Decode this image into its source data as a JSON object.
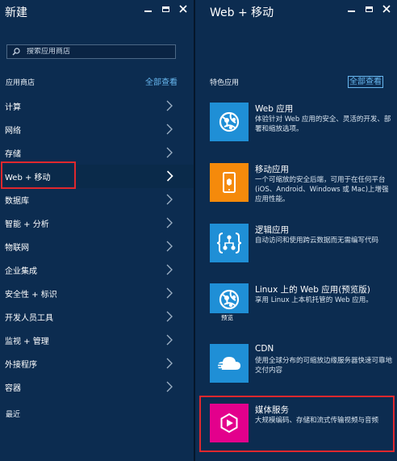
{
  "left_blade": {
    "title": "新建",
    "search_placeholder": "搜索应用商店",
    "section_label": "应用商店",
    "see_all": "全部查看",
    "menu": [
      {
        "label": "计算"
      },
      {
        "label": "网络"
      },
      {
        "label": "存储"
      },
      {
        "label": "Web + 移动",
        "active": true
      },
      {
        "label": "数据库"
      },
      {
        "label": "智能 + 分析"
      },
      {
        "label": "物联网"
      },
      {
        "label": "企业集成"
      },
      {
        "label": "安全性 + 标识"
      },
      {
        "label": "开发人员工具"
      },
      {
        "label": "监视 + 管理"
      },
      {
        "label": "外接程序"
      },
      {
        "label": "容器"
      }
    ],
    "recent_label": "最近"
  },
  "right_blade": {
    "title": "Web + 移动",
    "section_label": "特色应用",
    "see_all": "全部查看",
    "apps": [
      {
        "name": "Web 应用",
        "desc": "体验针对 Web 应用的安全、灵活的开发、部署和缩放选项。",
        "color": "#1f8fd6",
        "icon": "globe-icon"
      },
      {
        "name": "移动应用",
        "desc": "一个可缩放的安全后端，可用于在任何平台(iOS、Android、Windows 或 Mac)上增强应用性能。",
        "color": "#f58a0b",
        "icon": "mobile-app-icon"
      },
      {
        "name": "逻辑应用",
        "desc": "自动访问和使用跨云数据而无需编写代码",
        "color": "#1f8fd6",
        "icon": "logic-app-icon"
      },
      {
        "name": "Linux 上的 Web 应用(预览版)",
        "desc": "享用 Linux 上本机托管的 Web 应用。",
        "color": "#1f8fd6",
        "icon": "globe-icon",
        "tag": "预览"
      },
      {
        "name": "CDN",
        "desc": "使用全球分布的可缩放边缘服务器快速可靠地交付内容",
        "color": "#1f8fd6",
        "icon": "cloud-icon"
      },
      {
        "name": "媒体服务",
        "desc": "大规模编码、存储和流式传输视频与音频",
        "color": "#e3008c",
        "icon": "media-icon"
      }
    ]
  }
}
